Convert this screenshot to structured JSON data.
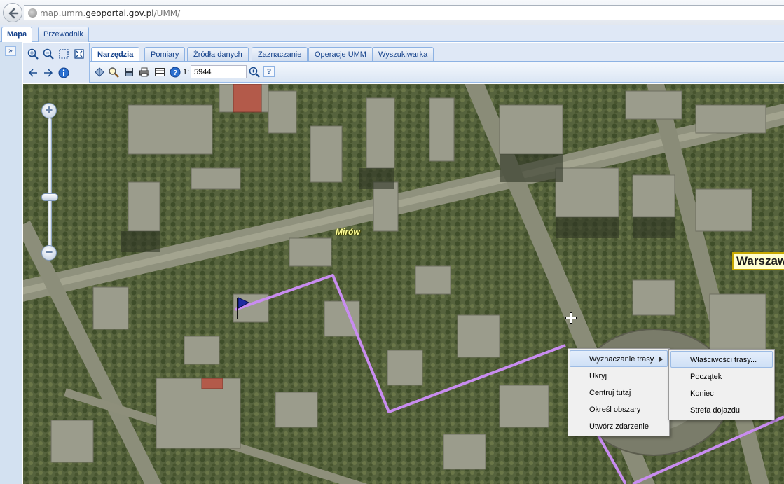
{
  "browser": {
    "url_prefix": "map.umm.",
    "url_domain": "geoportal.gov.pl",
    "url_path": "/UMM/"
  },
  "top_tabs": [
    {
      "label": "Mapa",
      "active": true
    },
    {
      "label": "Przewodnik",
      "active": false
    }
  ],
  "left_panel": {
    "expand_label": "»"
  },
  "inner_tabs": [
    {
      "label": "Narzędzia",
      "active": true
    },
    {
      "label": "Pomiary",
      "active": false
    },
    {
      "label": "Źródła danych",
      "active": false
    },
    {
      "label": "Zaznaczanie",
      "active": false
    },
    {
      "label": "Operacje UMM",
      "active": false
    },
    {
      "label": "Wyszukiwarka",
      "active": false
    }
  ],
  "scale": {
    "label": "1:",
    "value": "5944"
  },
  "icons": {
    "zoom_in": "zoom-in-icon",
    "zoom_out": "zoom-out-icon",
    "zoom_box": "zoom-box-icon",
    "full_extent": "full-extent-icon",
    "back": "arrow-left-icon",
    "forward": "arrow-right-icon",
    "info": "info-icon"
  },
  "map": {
    "labels": {
      "mirow": "Mirów",
      "warszawa": "Warszaw"
    },
    "zoom": {
      "plus": "+",
      "minus": "−"
    },
    "route_color": "#c88cf0"
  },
  "context_menu": {
    "items": [
      {
        "label": "Wyznaczanie trasy",
        "has_submenu": true,
        "highlighted": true
      },
      {
        "label": "Ukryj"
      },
      {
        "label": "Centruj tutaj"
      },
      {
        "label": "Określ obszary"
      },
      {
        "label": "Utwórz zdarzenie"
      }
    ]
  },
  "submenu": {
    "items": [
      {
        "label": "Właściwości trasy...",
        "highlighted": true
      },
      {
        "label": "Początek"
      },
      {
        "label": "Koniec"
      },
      {
        "label": "Strefa dojazdu"
      }
    ]
  }
}
